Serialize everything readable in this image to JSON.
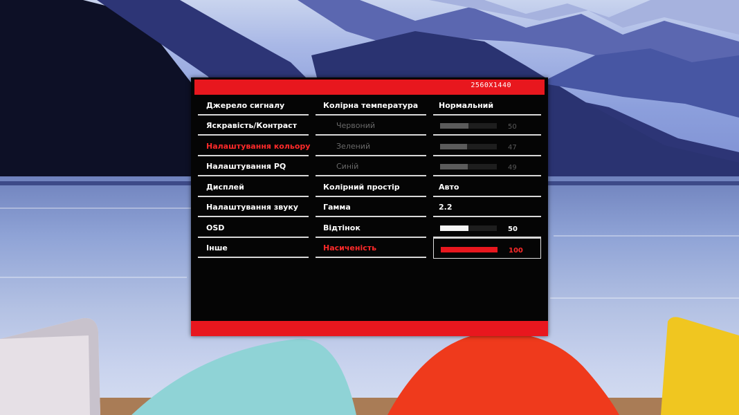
{
  "osd": {
    "resolution": "2560X1440",
    "accent_color": "#e8171e",
    "menu": [
      {
        "label": "Джерело сигналу"
      },
      {
        "label": "Яскравість/Контраст"
      },
      {
        "label": "Налаштування кольору",
        "active": true
      },
      {
        "label": "Налаштування PQ"
      },
      {
        "label": "Дисплей"
      },
      {
        "label": "Налаштування звуку"
      },
      {
        "label": "OSD"
      },
      {
        "label": "Інше"
      }
    ],
    "submenu": [
      {
        "label": "Колірна температура"
      },
      {
        "label": "Червоний",
        "disabled": true
      },
      {
        "label": "Зелений",
        "disabled": true
      },
      {
        "label": "Синій",
        "disabled": true
      },
      {
        "label": "Колірний простір"
      },
      {
        "label": "Гамма"
      },
      {
        "label": "Відтінок"
      },
      {
        "label": "Насиченість",
        "active": true
      }
    ],
    "values": {
      "color_temperature": "Нормальний",
      "red": {
        "value": "50",
        "level": 0.5
      },
      "green": {
        "value": "47",
        "level": 0.47
      },
      "blue": {
        "value": "49",
        "level": 0.49
      },
      "color_space": "Авто",
      "gamma": "2.2",
      "hue": {
        "value": "50",
        "level": 0.5
      },
      "saturation": {
        "value": "100",
        "level": 1.0
      }
    }
  }
}
